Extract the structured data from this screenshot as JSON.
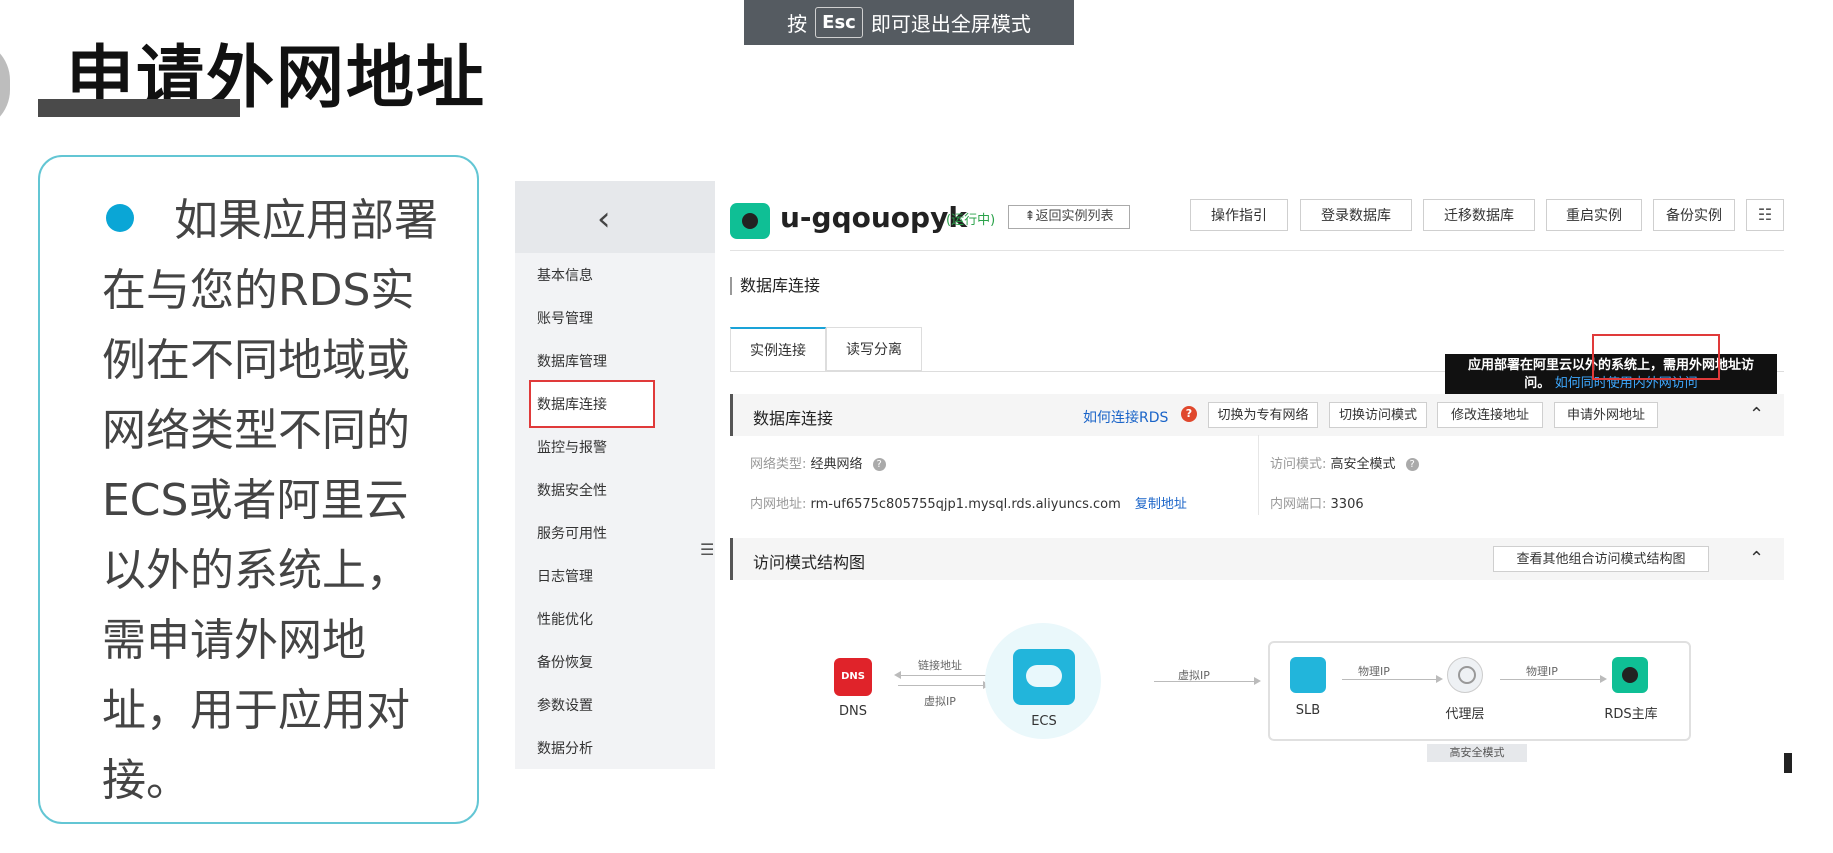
{
  "slide": {
    "title": "申请外网地址",
    "bullet": "如果应用部署在与您的RDS实例在不同地域或网络类型不同的ECS或者阿里云以外的系统上，需申请外网地址，用于应用对接。"
  },
  "esc_banner": {
    "before": "按",
    "key": "Esc",
    "after": "即可退出全屏模式"
  },
  "sidebar": {
    "back_icon": "chevron-left-icon",
    "items": [
      "基本信息",
      "账号管理",
      "数据库管理",
      "数据库连接",
      "监控与报警",
      "数据安全性",
      "服务可用性",
      "日志管理",
      "性能优化",
      "备份恢复",
      "参数设置",
      "数据分析"
    ],
    "active": "数据库连接"
  },
  "header": {
    "instance_name": "u-gqouopyk",
    "status": "(运行中)",
    "back_list": "⇞返回实例列表",
    "buttons": [
      "操作指引",
      "登录数据库",
      "迁移数据库",
      "重启实例",
      "备份实例"
    ],
    "menu_icon": "list-icon"
  },
  "page_title": "数据库连接",
  "tabs": [
    "实例连接",
    "读写分离"
  ],
  "tooltip": {
    "line1": "应用部署在阿里云以外的系统上，需用外网地址访",
    "line2": "问。",
    "link": "如何同时使用内外网访问"
  },
  "connection_panel": {
    "title": "数据库连接",
    "help_link": "如何连接RDS",
    "help_icon": "?",
    "buttons": [
      "切换为专有网络",
      "切换访问模式",
      "修改连接地址",
      "申请外网地址"
    ],
    "network_type_label": "网络类型:",
    "network_type_value": "经典网络",
    "access_mode_label": "访问模式:",
    "access_mode_value": "高安全模式",
    "intranet_addr_label": "内网地址:",
    "intranet_addr_value": "rm-uf6575c805755qjp1.mysql.rds.aliyuncs.com",
    "copy_link": "复制地址",
    "intranet_port_label": "内网端口:",
    "intranet_port_value": "3306"
  },
  "diagram_panel": {
    "title": "访问模式结构图",
    "view_other_button": "查看其他组合访问模式结构图",
    "nodes": {
      "dns": "DNS",
      "ecs": "ECS",
      "slb": "SLB",
      "proxy": "代理层",
      "rds": "RDS主库"
    },
    "dns_icon_text": "DNS",
    "edges": {
      "link_addr": "链接地址",
      "virtual_ip_1": "虚拟IP",
      "virtual_ip_2": "虚拟IP",
      "physical_ip_1": "物理IP",
      "physical_ip_2": "物理IP"
    },
    "mode_tag": "高安全模式"
  },
  "colors": {
    "accent": "#1aa3d8",
    "highlight_red": "#e03a3a",
    "link_blue": "#1a64c8",
    "status_green": "#2aa24a",
    "bullet_blue": "#0aa6d6"
  }
}
